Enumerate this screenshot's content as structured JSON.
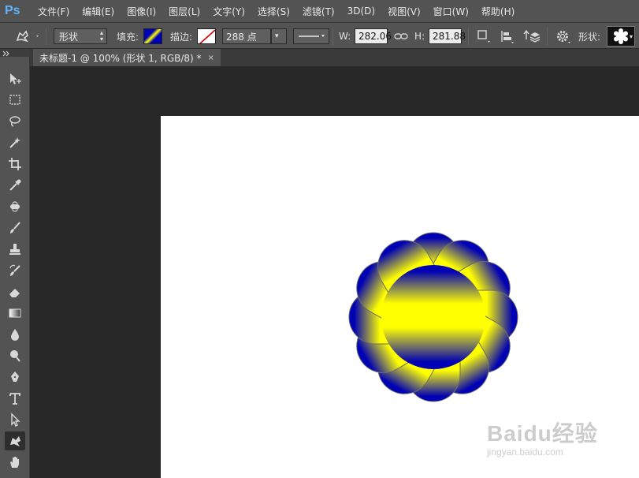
{
  "app": {
    "logo": "Ps"
  },
  "menu": [
    "文件(F)",
    "编辑(E)",
    "图像(I)",
    "图层(L)",
    "文字(Y)",
    "选择(S)",
    "滤镜(T)",
    "3D(D)",
    "视图(V)",
    "窗口(W)",
    "帮助(H)"
  ],
  "options": {
    "mode_value": "形状",
    "fill_label": "填充:",
    "stroke_label": "描边:",
    "stroke_size": "288 点",
    "width_label": "W:",
    "width_value": "282.06",
    "height_label": "H:",
    "height_value": "281.88",
    "shape_label": "形状:"
  },
  "document": {
    "tab_title": "未标题-1 @ 100% (形状 1, RGB/8) *",
    "close_glyph": "×"
  },
  "shape": {
    "gradient_stops": [
      "#0000b4",
      "#ffff00",
      "#ffff00",
      "#0000b4"
    ]
  },
  "watermark": {
    "main": "Baidu经验",
    "sub": "jingyan.baidu.com"
  },
  "tools": [
    "move-icon",
    "marquee-icon",
    "lasso-icon",
    "magic-wand-icon",
    "crop-icon",
    "eyedropper-icon",
    "healing-brush-icon",
    "brush-icon",
    "clone-stamp-icon",
    "history-brush-icon",
    "eraser-icon",
    "gradient-icon",
    "blur-icon",
    "dodge-icon",
    "pen-icon",
    "type-icon",
    "path-selection-icon",
    "custom-shape-icon",
    "hand-icon",
    "zoom-icon"
  ]
}
